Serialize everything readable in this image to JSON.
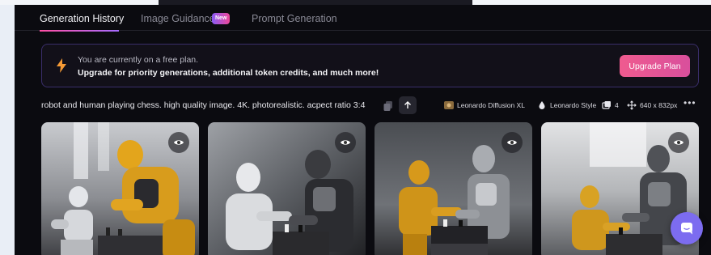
{
  "tabs": [
    {
      "label": "Generation History",
      "active": true
    },
    {
      "label": "Image Guidance",
      "active": false,
      "badge": "New"
    },
    {
      "label": "Prompt Generation",
      "active": false
    }
  ],
  "banner": {
    "line1": "You are currently on a free plan.",
    "line2": "Upgrade for priority generations, additional token credits, and much more!",
    "button_label": "Upgrade Plan",
    "icon": "bolt-icon"
  },
  "generation": {
    "prompt": "robot and human playing chess. high quality image. 4K. photorealistic. acpect ratio 3:4",
    "model": "Leonardo Diffusion XL",
    "style": "Leonardo Style",
    "count": "4",
    "dimensions": "640 x 832px"
  },
  "images": [
    {
      "name": "generated-image-1"
    },
    {
      "name": "generated-image-2"
    },
    {
      "name": "generated-image-3"
    },
    {
      "name": "generated-image-4"
    }
  ],
  "colors": {
    "accent_pink": "#ef5b8f",
    "accent_purple": "#7c6cf0",
    "bolt_orange": "#f59a35",
    "background": "#0b0b10"
  }
}
